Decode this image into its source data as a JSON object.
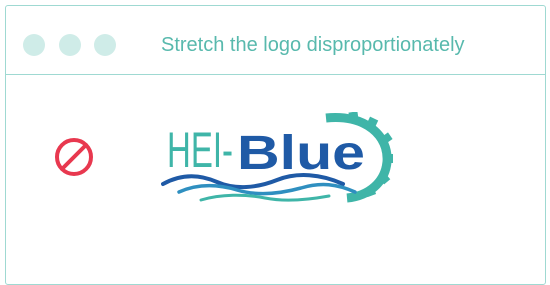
{
  "window": {
    "title": "Stretch the logo disproportionately"
  },
  "icons": {
    "prohibited": "prohibited-icon"
  },
  "logo": {
    "text_left": "HEI-",
    "text_bold": "Blue",
    "name": "HEI-Blue logo"
  },
  "colors": {
    "border": "#9fd9d2",
    "title": "#58b9ad",
    "dots": "#cfece8",
    "prohibited": "#e8384f",
    "logo_teal": "#3fb5a8",
    "logo_blue": "#1f5aa6"
  }
}
